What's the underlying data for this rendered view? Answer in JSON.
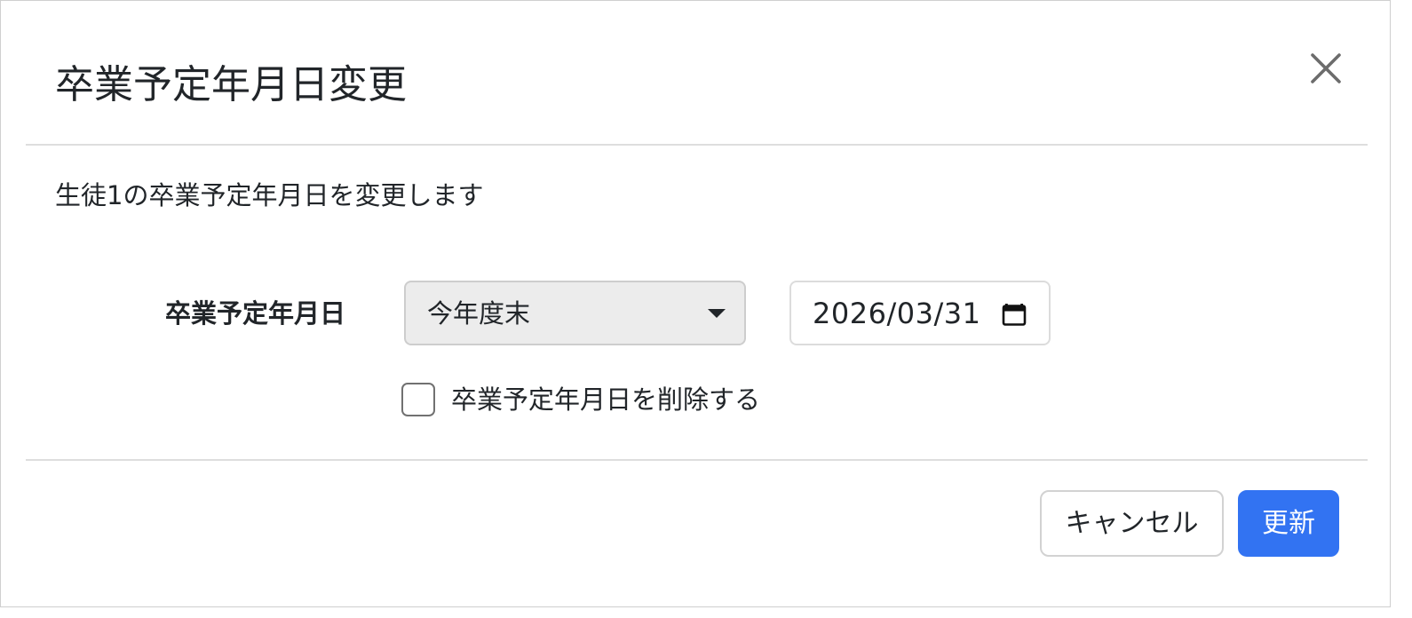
{
  "modal": {
    "title": "卒業予定年月日変更",
    "description": "生徒1の卒業予定年月日を変更します"
  },
  "form": {
    "field_label": "卒業予定年月日",
    "select": {
      "selected": "今年度末"
    },
    "date": {
      "value": "2026/03/31"
    },
    "delete_checkbox": {
      "label": "卒業予定年月日を削除する",
      "checked": false
    }
  },
  "footer": {
    "cancel_label": "キャンセル",
    "submit_label": "更新"
  },
  "colors": {
    "primary": "#3273f2",
    "select_bg": "#ececec",
    "text": "#212529"
  },
  "icons": {
    "close": "close-icon",
    "caret": "caret-down-icon",
    "calendar": "calendar-icon"
  }
}
